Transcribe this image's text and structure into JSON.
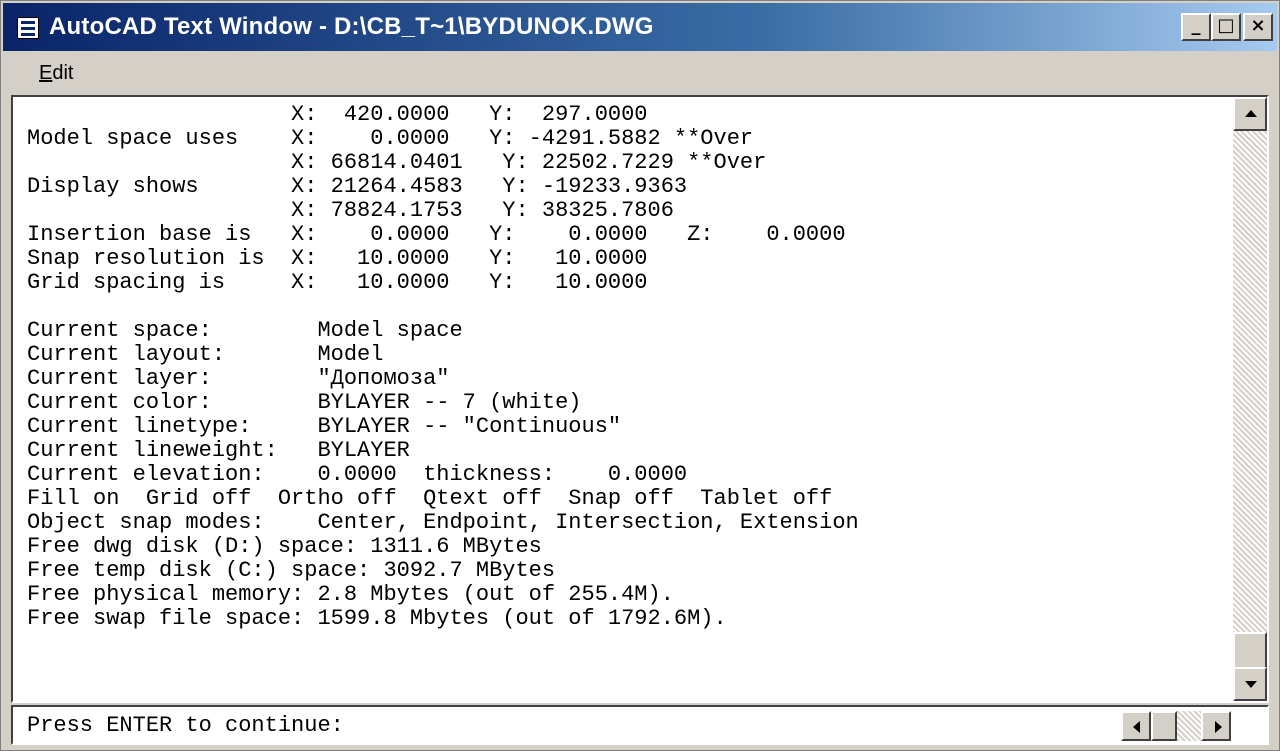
{
  "window": {
    "title": "AutoCAD Text Window - D:\\CB_T~1\\BYDUNOK.DWG",
    "minimize_glyph": "_",
    "maximize_glyph": "□",
    "close_glyph": "×"
  },
  "menu": {
    "edit": "Edit"
  },
  "history": {
    "lines": [
      "                    X:  420.0000   Y:  297.0000",
      "Model space uses    X:    0.0000   Y: -4291.5882 **Over",
      "                    X: 66814.0401   Y: 22502.7229 **Over",
      "Display shows       X: 21264.4583   Y: -19233.9363",
      "                    X: 78824.1753   Y: 38325.7806",
      "Insertion base is   X:    0.0000   Y:    0.0000   Z:    0.0000",
      "Snap resolution is  X:   10.0000   Y:   10.0000",
      "Grid spacing is     X:   10.0000   Y:   10.0000",
      "",
      "Current space:        Model space",
      "Current layout:       Model",
      "Current layer:        \"Допомоза\"",
      "Current color:        BYLAYER -- 7 (white)",
      "Current linetype:     BYLAYER -- \"Continuous\"",
      "Current lineweight:   BYLAYER",
      "Current elevation:    0.0000  thickness:    0.0000",
      "Fill on  Grid off  Ortho off  Qtext off  Snap off  Tablet off",
      "Object snap modes:    Center, Endpoint, Intersection, Extension",
      "Free dwg disk (D:) space: 1311.6 MBytes",
      "Free temp disk (C:) space: 3092.7 MBytes",
      "Free physical memory: 2.8 Mbytes (out of 255.4M).",
      "Free swap file space: 1599.8 Mbytes (out of 1792.6M)."
    ]
  },
  "command_line": {
    "prompt": "Press ENTER to continue:"
  }
}
